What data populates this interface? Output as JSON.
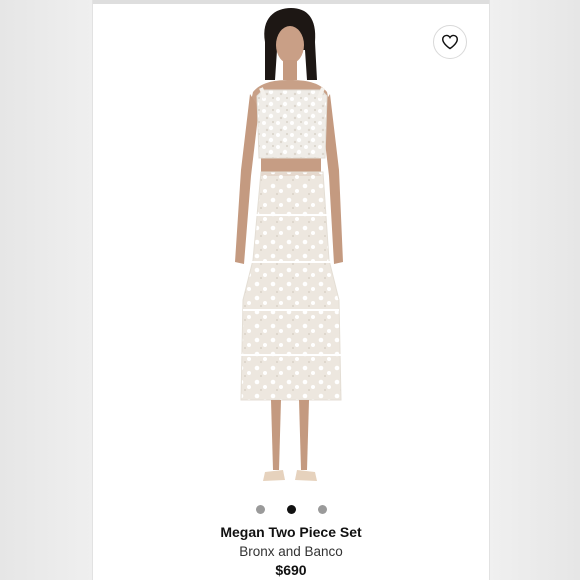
{
  "product": {
    "name": "Megan Two Piece Set",
    "brand": "Bronx and Banco",
    "price": "$690"
  },
  "gallery": {
    "image_count": 3,
    "active_index": 2
  },
  "icons": {
    "favorite": "heart-icon"
  },
  "colors": {
    "text_primary": "#111111",
    "dot_active": "#111111",
    "dot_inactive": "#9a9a9a",
    "background": "#ffffff"
  }
}
